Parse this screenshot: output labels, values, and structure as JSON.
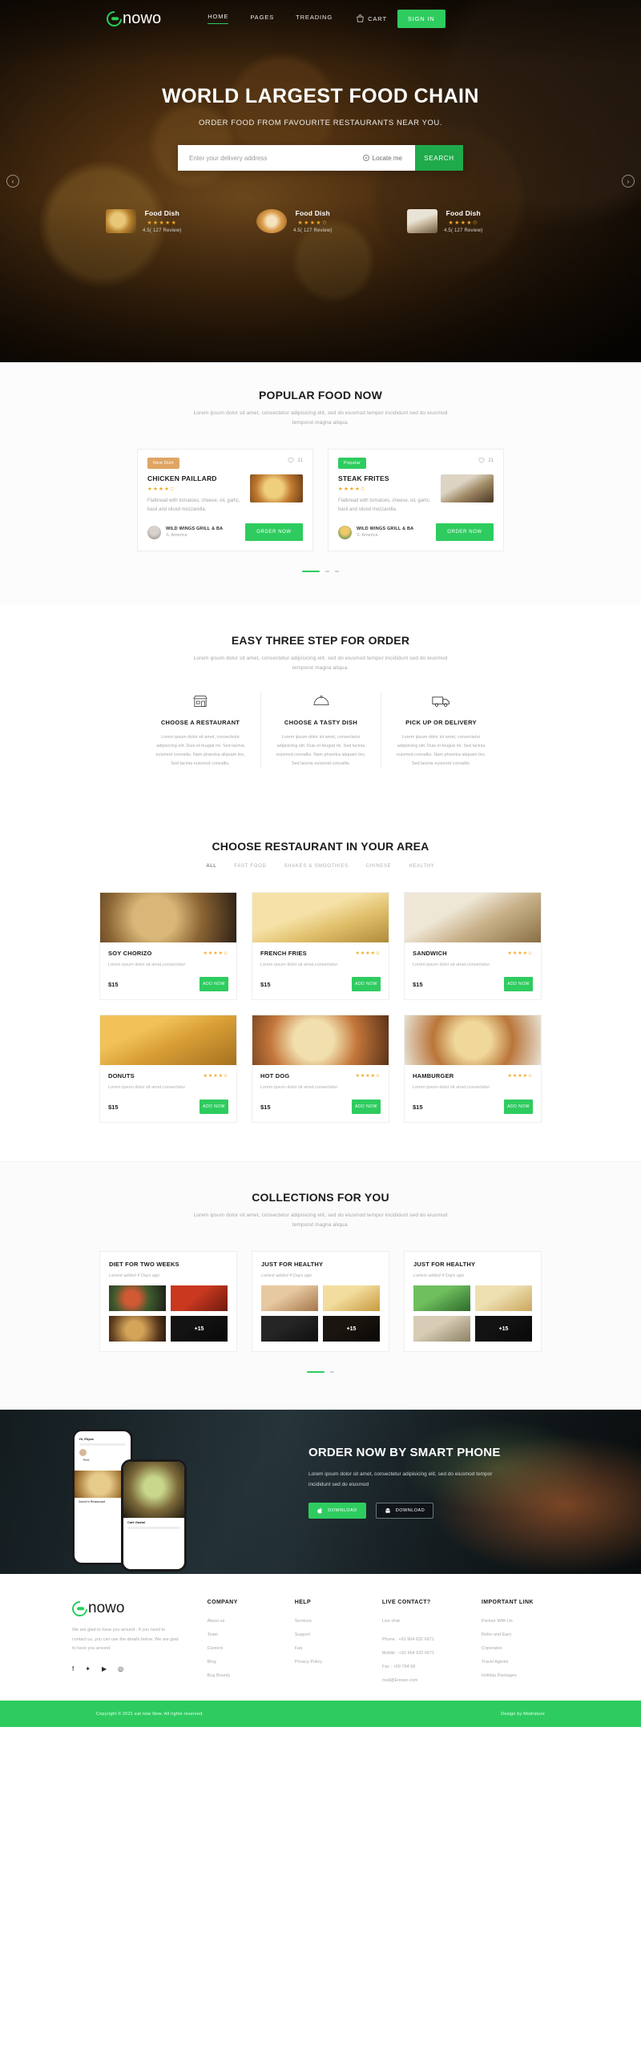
{
  "brand": {
    "name": "nowo",
    "logo_icon": "leaf-circle-icon"
  },
  "nav": {
    "links": [
      {
        "label": "HOME",
        "active": true
      },
      {
        "label": "PAGES",
        "active": false
      },
      {
        "label": "TREADING",
        "active": false
      }
    ],
    "cart_label": "CART",
    "cart_icon": "shopping-bag-icon",
    "signin_label": "SIGN IN"
  },
  "hero": {
    "title": "WORLD LARGEST FOOD CHAIN",
    "subtitle": "ORDER FOOD FROM FAVOURITE RESTAURANTS NEAR YOU.",
    "search_placeholder": "Enter your delivery address",
    "search_value": "",
    "locate_label": "Locate me",
    "locate_icon": "location-pin-icon",
    "search_button": "SEARCH",
    "prev_icon": "chevron-left-icon",
    "next_icon": "chevron-right-icon",
    "dishes": [
      {
        "name": "Food Dish",
        "stars": "★★★★★",
        "rating": "4.5( 127 Review)"
      },
      {
        "name": "Food Dish",
        "stars": "★★★★✩",
        "rating": "4.5( 127 Review)"
      },
      {
        "name": "Food Dish",
        "stars": "★★★★✩",
        "rating": "4.5( 127 Review)"
      }
    ]
  },
  "popular": {
    "title": "POPULAR FOOD NOW",
    "subtitle": "Lorem ipsum dolor sit amet, consectetur adipisicing elit, sed do eiusmod tempor incididunt sed do eiusmod temporut magna aliqua.",
    "cards": [
      {
        "badge": "New Dish",
        "likes": "21",
        "heart_icon": "heart-outline-icon",
        "name": "CHICKEN PAILLARD",
        "stars": "★★★★✩",
        "desc": "Flatbread with tomatoes, cheese, oil, garlic, basil and sliced mozzarella.",
        "restaurant": "WILD WINGS GRILL & BA",
        "location": "S. America",
        "order_label": "ORDER NOW"
      },
      {
        "badge": "Popular",
        "likes": "21",
        "heart_icon": "heart-outline-icon",
        "name": "STEAK FRITES",
        "stars": "★★★★✩",
        "desc": "Flatbread with tomatoes, cheese, oil, garlic, basil and sliced mozzarella.",
        "restaurant": "WILD WINGS GRILL & BA",
        "location": "S. America",
        "order_label": "ORDER NOW"
      }
    ]
  },
  "steps": {
    "title": "EASY THREE STEP FOR ORDER",
    "subtitle": "Lorem ipsum dolor sit amet, consectetur adipisicing elit, sed do eiusmod tempor incididunt sed do eiusmod temporut magna aliqua.",
    "items": [
      {
        "icon": "storefront-icon",
        "title": "CHOOSE A RESTAURANT",
        "desc": "Lorem ipsum dolor sit amet, consectetur adipisicing elit. Duis et feugiat mi. Sed lacinia euismod convallis. Nam pharetra aliquam leo, Sed lacinia euismod convallis."
      },
      {
        "icon": "food-cloche-icon",
        "title": "CHOOSE A TASTY DISH",
        "desc": "Lorem ipsum dolor sit amet, consectetur adipisicing elit. Duis et feugiat mi. Sed lacinia euismod convallis. Nam pharetra aliquam leo, Sed lacinia euismod convallis."
      },
      {
        "icon": "delivery-truck-icon",
        "title": "PICK UP OR DELIVERY",
        "desc": "Lorem ipsum dolor sit amet, consectetur adipisicing elit. Duis et feugiat mi. Sed lacinia euismod convallis. Nam pharetra aliquam leo, Sed lacinia euismod convallis."
      }
    ]
  },
  "restaurants": {
    "title": "CHOOSE RESTAURANT IN YOUR AREA",
    "tabs": [
      {
        "label": "ALL",
        "active": true
      },
      {
        "label": "FAST FOOD",
        "active": false
      },
      {
        "label": "SHAKES & SMOOTHIES",
        "active": false
      },
      {
        "label": "CHINESE",
        "active": false
      },
      {
        "label": "HEALTHY",
        "active": false
      }
    ],
    "cards": [
      {
        "name": "SOY CHORIZO",
        "stars": "★★★★✩",
        "desc": "Lorem ipsum dolor sit amet,consectetur",
        "price": "$15",
        "add_label": "ADD NOW"
      },
      {
        "name": "FRENCH FRIES",
        "stars": "★★★★✩",
        "desc": "Lorem ipsum dolor sit amet,consectetur",
        "price": "$15",
        "add_label": "ADD NOW"
      },
      {
        "name": "SANDWICH",
        "stars": "★★★★✩",
        "desc": "Lorem ipsum dolor sit amet,consectetur",
        "price": "$15",
        "add_label": "ADD NOW"
      },
      {
        "name": "DONUTS",
        "stars": "★★★★✩",
        "desc": "Lorem ipsum dolor sit amet,consectetur",
        "price": "$15",
        "add_label": "ADD NOW"
      },
      {
        "name": "HOT DOG",
        "stars": "★★★★✩",
        "desc": "Lorem ipsum dolor sit amet,consectetur",
        "price": "$15",
        "add_label": "ADD NOW"
      },
      {
        "name": "HAMBURGER",
        "stars": "★★★★✩",
        "desc": "Lorem ipsum dolor sit amet,consectetur",
        "price": "$15",
        "add_label": "ADD NOW"
      }
    ]
  },
  "collections": {
    "title": "COLLECTIONS FOR YOU",
    "subtitle": "Lorem ipsum dolor sit amet, consectetur adipisicing elit, sed do eiusmod tempor incididunt sed do eiusmod temporut magna aliqua.",
    "cards": [
      {
        "title": "DIET FOR TWO WEEKS",
        "meta": "Lartest added 4 Days ago",
        "more": "+15"
      },
      {
        "title": "JUST FOR HEALTHY",
        "meta": "Lartest added 4 Days ago",
        "more": "+15"
      },
      {
        "title": "JUST FOR HEALTHY",
        "meta": "Lartest added 4 Days ago",
        "more": "+15"
      }
    ]
  },
  "phone_banner": {
    "title": "ORDER NOW BY SMART PHONE",
    "desc": "Lorem ipsum dolor sit amet, consectetur adipisicing elit, sed do eiusmod tempor incididunt sed do eiusmod",
    "apple_label": "DOWNLOAD",
    "apple_icon": "apple-icon",
    "android_label": "DOWNLOAD",
    "android_icon": "android-icon",
    "mock_hi": "Hi, Ellyas",
    "mock_caption": "Career's Restaurant",
    "mock_foot": "Cafe Gastal",
    "mock_free": "Free"
  },
  "footer": {
    "about": "We are glad to have you around . If you need to contact us, you can use the details below. We are glad to have you around.",
    "socials": [
      {
        "icon": "facebook-icon",
        "glyph": "f"
      },
      {
        "icon": "twitter-icon",
        "glyph": "✦"
      },
      {
        "icon": "youtube-icon",
        "glyph": "▶"
      },
      {
        "icon": "instagram-icon",
        "glyph": "◎"
      }
    ],
    "columns": [
      {
        "heading": "COMPANY",
        "links": [
          "About us",
          "Team",
          "Careers",
          "Blog",
          "Bug Bounty"
        ]
      },
      {
        "heading": "HELP",
        "links": [
          "Services",
          "Support",
          "Faq",
          "Privacy Policy"
        ]
      },
      {
        "heading": "LIVE CONTACT?",
        "links": [
          "Live chat",
          "Phone : +91 964 632 6671",
          "Mobile : +91 964 632 6671",
          "Fax : +59 794 58",
          "mail@Enowo.com"
        ]
      },
      {
        "heading": "IMPORTANT LINK",
        "links": [
          "Partner With Us",
          "Refer and Earn",
          "Coporates",
          "Travel Agents",
          "Holiday Packages"
        ]
      }
    ],
    "copyright": "Copyright © 2021 eat now Now. All rights reserved.",
    "design_by": "Design by Modrature"
  },
  "colors": {
    "accent": "#2ecc5f",
    "accent_dark": "#1faa4c",
    "star": "#f0a821",
    "badge_orange": "#dfa564"
  }
}
